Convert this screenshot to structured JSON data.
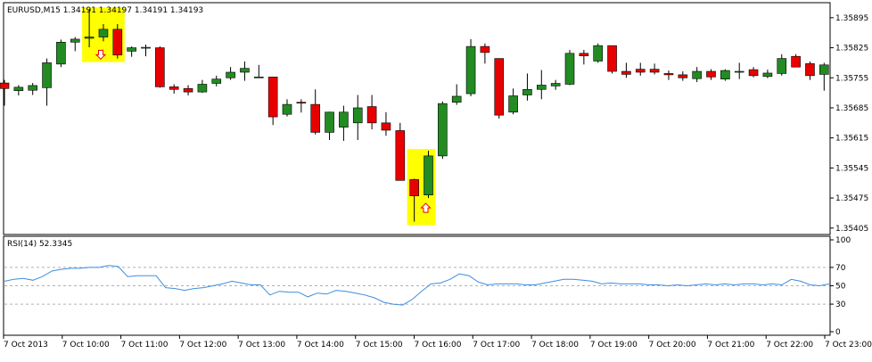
{
  "main_panel": {
    "header": "EURUSD,M15  1.34191 1.34197 1.34191 1.34193"
  },
  "rsi_panel": {
    "header": "RSI(14) 52.3345"
  },
  "colors": {
    "bull": "#228B22",
    "bear": "#E80000",
    "highlight": "#FFFF00",
    "rsi_line": "#3D8DE0",
    "arrow": "#E80000",
    "level": "#B0B0B0",
    "frame": "#000000"
  },
  "chart_data": [
    {
      "type": "candlestick",
      "symbol": "EURUSD",
      "timeframe": "M15",
      "ylim": [
        1.3539,
        1.3593
      ],
      "y_ticks": [
        "1.35895",
        "1.35825",
        "1.35755",
        "1.35685",
        "1.35615",
        "1.35545",
        "1.35475",
        "1.35405"
      ],
      "x_labels": [
        "7 Oct 2013",
        "7 Oct 10:00",
        "7 Oct 11:00",
        "7 Oct 12:00",
        "7 Oct 13:00",
        "7 Oct 14:00",
        "7 Oct 15:00",
        "7 Oct 16:00",
        "7 Oct 17:00",
        "7 Oct 18:00",
        "7 Oct 19:00",
        "7 Oct 20:00",
        "7 Oct 21:00",
        "7 Oct 22:00",
        "7 Oct 23:00"
      ],
      "candles": [
        {
          "o": 1.35743,
          "h": 1.3575,
          "l": 1.3569,
          "c": 1.3573
        },
        {
          "o": 1.35725,
          "h": 1.35738,
          "l": 1.35714,
          "c": 1.35733
        },
        {
          "o": 1.35726,
          "h": 1.35743,
          "l": 1.35715,
          "c": 1.35737
        },
        {
          "o": 1.35732,
          "h": 1.358,
          "l": 1.3569,
          "c": 1.3579
        },
        {
          "o": 1.35787,
          "h": 1.35844,
          "l": 1.3578,
          "c": 1.35838
        },
        {
          "o": 1.35838,
          "h": 1.3585,
          "l": 1.35817,
          "c": 1.35845
        },
        {
          "o": 1.35847,
          "h": 1.35915,
          "l": 1.35826,
          "c": 1.3585
        },
        {
          "o": 1.3585,
          "h": 1.3588,
          "l": 1.3584,
          "c": 1.35868
        },
        {
          "o": 1.35868,
          "h": 1.3588,
          "l": 1.358,
          "c": 1.35808
        },
        {
          "o": 1.35817,
          "h": 1.35828,
          "l": 1.35804,
          "c": 1.35825
        },
        {
          "o": 1.35825,
          "h": 1.35832,
          "l": 1.35805,
          "c": 1.35826
        },
        {
          "o": 1.35825,
          "h": 1.35828,
          "l": 1.35732,
          "c": 1.35734
        },
        {
          "o": 1.35734,
          "h": 1.3574,
          "l": 1.35718,
          "c": 1.35728
        },
        {
          "o": 1.3573,
          "h": 1.35738,
          "l": 1.35714,
          "c": 1.35722
        },
        {
          "o": 1.35722,
          "h": 1.3575,
          "l": 1.3572,
          "c": 1.3574
        },
        {
          "o": 1.35742,
          "h": 1.3576,
          "l": 1.35735,
          "c": 1.35752
        },
        {
          "o": 1.35755,
          "h": 1.3578,
          "l": 1.3575,
          "c": 1.35768
        },
        {
          "o": 1.35768,
          "h": 1.35793,
          "l": 1.35748,
          "c": 1.35777
        },
        {
          "o": 1.35757,
          "h": 1.35785,
          "l": 1.35757,
          "c": 1.35757
        },
        {
          "o": 1.35757,
          "h": 1.35757,
          "l": 1.35645,
          "c": 1.35664
        },
        {
          "o": 1.3567,
          "h": 1.35705,
          "l": 1.35665,
          "c": 1.35693
        },
        {
          "o": 1.35698,
          "h": 1.35705,
          "l": 1.35674,
          "c": 1.35697
        },
        {
          "o": 1.35693,
          "h": 1.35728,
          "l": 1.35623,
          "c": 1.35628
        },
        {
          "o": 1.35628,
          "h": 1.35676,
          "l": 1.3561,
          "c": 1.35675
        },
        {
          "o": 1.3564,
          "h": 1.3569,
          "l": 1.35608,
          "c": 1.35675
        },
        {
          "o": 1.3565,
          "h": 1.35715,
          "l": 1.3561,
          "c": 1.35685
        },
        {
          "o": 1.35688,
          "h": 1.35715,
          "l": 1.35635,
          "c": 1.3565
        },
        {
          "o": 1.3565,
          "h": 1.35675,
          "l": 1.3562,
          "c": 1.35633
        },
        {
          "o": 1.35632,
          "h": 1.3565,
          "l": 1.3554,
          "c": 1.35516
        },
        {
          "o": 1.35518,
          "h": 1.3552,
          "l": 1.3542,
          "c": 1.3548
        },
        {
          "o": 1.35482,
          "h": 1.35585,
          "l": 1.35475,
          "c": 1.35573
        },
        {
          "o": 1.35573,
          "h": 1.357,
          "l": 1.35566,
          "c": 1.35695
        },
        {
          "o": 1.35698,
          "h": 1.3574,
          "l": 1.35692,
          "c": 1.35712
        },
        {
          "o": 1.35718,
          "h": 1.35845,
          "l": 1.35712,
          "c": 1.35828
        },
        {
          "o": 1.35828,
          "h": 1.35835,
          "l": 1.35788,
          "c": 1.35814
        },
        {
          "o": 1.358,
          "h": 1.358,
          "l": 1.3566,
          "c": 1.35668
        },
        {
          "o": 1.35675,
          "h": 1.3573,
          "l": 1.3567,
          "c": 1.35713
        },
        {
          "o": 1.35715,
          "h": 1.35765,
          "l": 1.35702,
          "c": 1.35728
        },
        {
          "o": 1.35728,
          "h": 1.35773,
          "l": 1.35705,
          "c": 1.35738
        },
        {
          "o": 1.35736,
          "h": 1.3575,
          "l": 1.35727,
          "c": 1.35742
        },
        {
          "o": 1.3574,
          "h": 1.3582,
          "l": 1.35738,
          "c": 1.35812
        },
        {
          "o": 1.35812,
          "h": 1.3582,
          "l": 1.35786,
          "c": 1.35806
        },
        {
          "o": 1.35794,
          "h": 1.35835,
          "l": 1.3579,
          "c": 1.3583
        },
        {
          "o": 1.3583,
          "h": 1.3583,
          "l": 1.35765,
          "c": 1.3577
        },
        {
          "o": 1.3577,
          "h": 1.3579,
          "l": 1.35755,
          "c": 1.35763
        },
        {
          "o": 1.35775,
          "h": 1.3579,
          "l": 1.3576,
          "c": 1.35768
        },
        {
          "o": 1.35775,
          "h": 1.35788,
          "l": 1.35763,
          "c": 1.35768
        },
        {
          "o": 1.35765,
          "h": 1.35772,
          "l": 1.3575,
          "c": 1.35762
        },
        {
          "o": 1.35762,
          "h": 1.3577,
          "l": 1.35748,
          "c": 1.35755
        },
        {
          "o": 1.35753,
          "h": 1.3578,
          "l": 1.35745,
          "c": 1.3577
        },
        {
          "o": 1.3577,
          "h": 1.35775,
          "l": 1.3575,
          "c": 1.35757
        },
        {
          "o": 1.35752,
          "h": 1.35775,
          "l": 1.35748,
          "c": 1.35772
        },
        {
          "o": 1.3577,
          "h": 1.3579,
          "l": 1.35752,
          "c": 1.3577
        },
        {
          "o": 1.35774,
          "h": 1.3578,
          "l": 1.35756,
          "c": 1.3576
        },
        {
          "o": 1.35758,
          "h": 1.35774,
          "l": 1.35754,
          "c": 1.35766
        },
        {
          "o": 1.35765,
          "h": 1.3581,
          "l": 1.3576,
          "c": 1.358
        },
        {
          "o": 1.35805,
          "h": 1.3581,
          "l": 1.3578,
          "c": 1.3578
        },
        {
          "o": 1.35788,
          "h": 1.35793,
          "l": 1.3575,
          "c": 1.3576
        },
        {
          "o": 1.35763,
          "h": 1.3579,
          "l": 1.35725,
          "c": 1.35785
        }
      ],
      "highlight_candles": [
        6,
        7,
        8,
        29,
        30
      ],
      "arrows": [
        {
          "candle": 7,
          "direction": "down"
        },
        {
          "candle": 30,
          "direction": "up"
        }
      ]
    },
    {
      "type": "line",
      "name": "RSI(14)",
      "ylim": [
        0,
        100
      ],
      "y_ticks": [
        "100",
        "70",
        "50",
        "30",
        "0"
      ],
      "levels": [
        70,
        50,
        30
      ],
      "values": [
        55,
        57,
        58,
        56,
        60,
        66,
        68,
        69,
        69,
        70,
        70,
        72,
        71,
        60,
        61,
        61,
        61,
        48,
        47,
        45,
        47,
        48,
        50,
        52,
        55,
        53,
        51,
        51,
        40,
        44,
        43,
        43,
        38,
        42,
        41,
        45,
        44,
        42,
        40,
        37,
        32,
        30,
        29,
        35,
        44,
        52,
        53,
        57,
        63,
        61,
        54,
        51,
        52,
        52,
        52,
        51,
        51,
        53,
        55,
        57,
        57,
        56,
        55,
        52,
        53,
        52,
        52,
        52,
        51,
        51,
        50,
        51,
        50,
        51,
        52,
        51,
        52,
        51,
        52,
        52,
        51,
        52,
        51,
        57,
        55,
        51,
        50,
        52
      ]
    }
  ]
}
